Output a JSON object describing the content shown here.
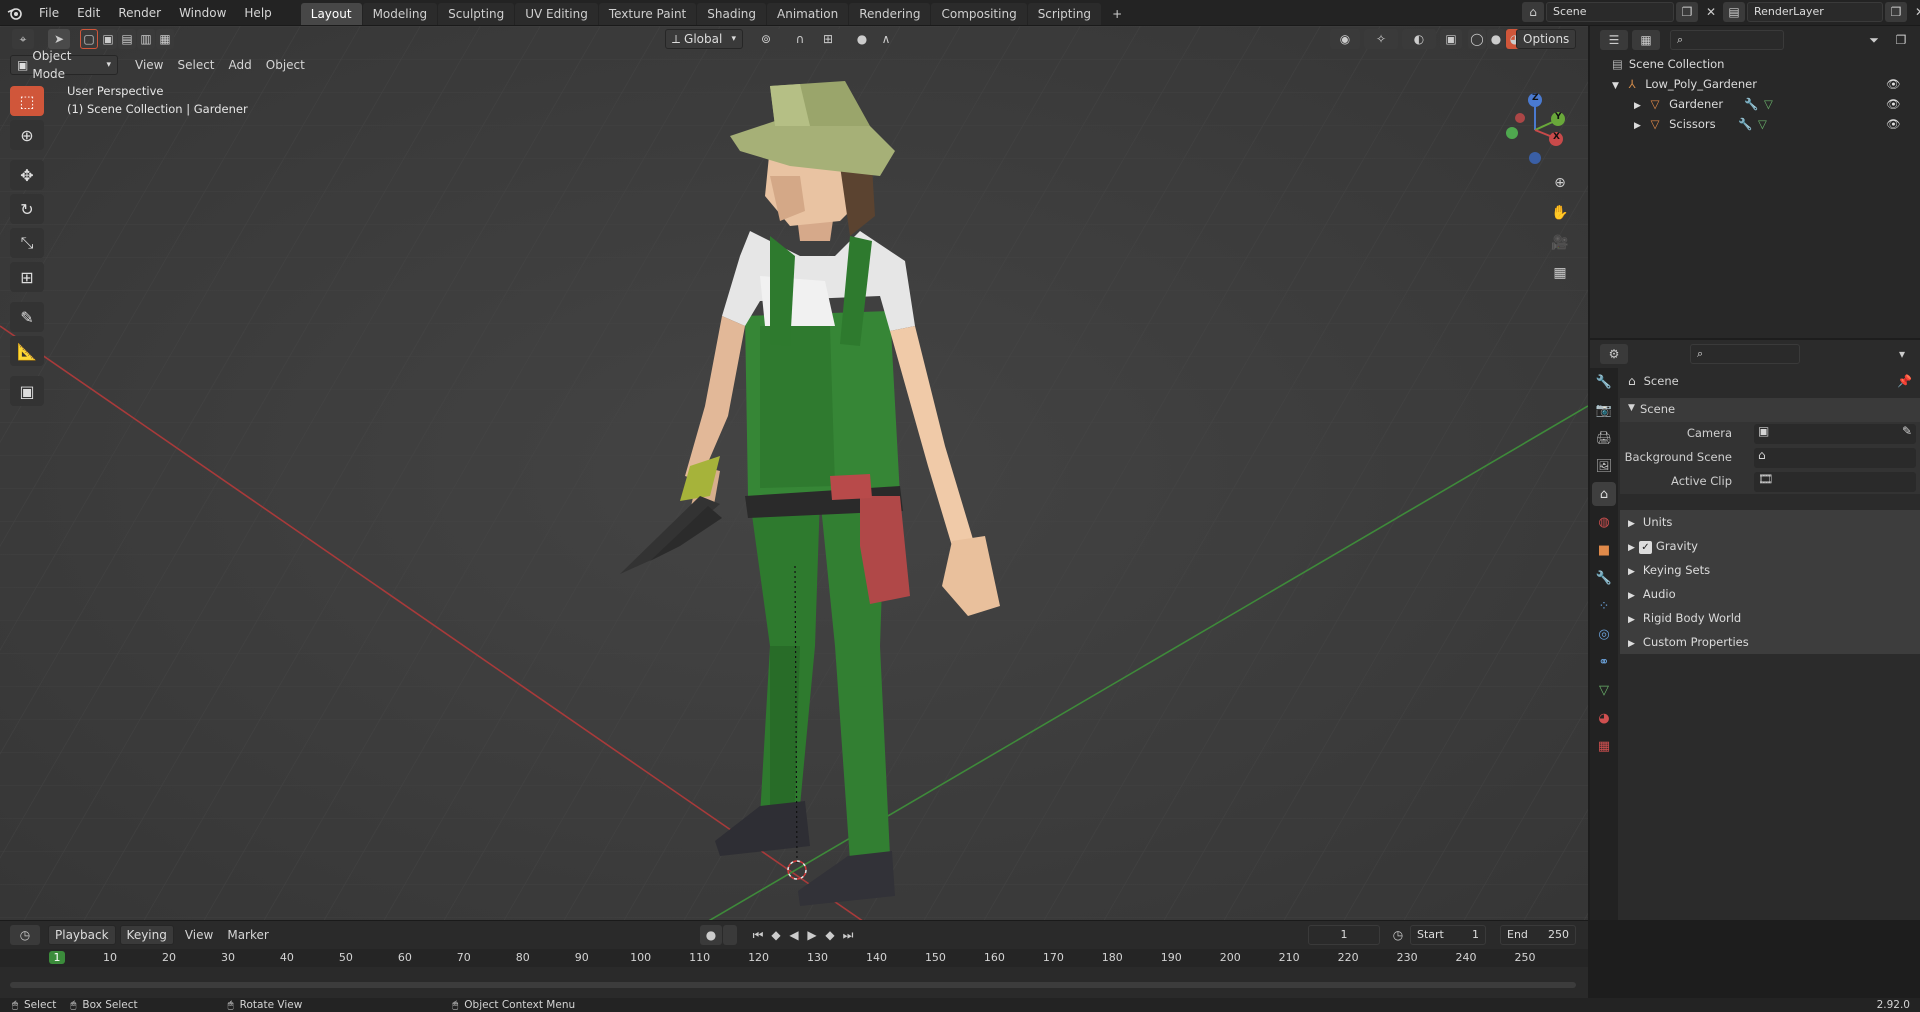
{
  "menu": [
    "File",
    "Edit",
    "Render",
    "Window",
    "Help"
  ],
  "workspaces": [
    {
      "label": "Layout",
      "active": true
    },
    {
      "label": "Modeling",
      "active": false
    },
    {
      "label": "Sculpting",
      "active": false
    },
    {
      "label": "UV Editing",
      "active": false
    },
    {
      "label": "Texture Paint",
      "active": false
    },
    {
      "label": "Shading",
      "active": false
    },
    {
      "label": "Animation",
      "active": false
    },
    {
      "label": "Rendering",
      "active": false
    },
    {
      "label": "Compositing",
      "active": false
    },
    {
      "label": "Scripting",
      "active": false
    }
  ],
  "add_workspace": "+",
  "scene_name": "Scene",
  "view_layer": "RenderLayer",
  "viewport_header": {
    "mode": "Object Mode",
    "menus": [
      "View",
      "Select",
      "Add",
      "Object"
    ],
    "orientation": "Global",
    "options": "Options"
  },
  "viewport_info": {
    "line1": "User Perspective",
    "line2": "(1) Scene Collection | Gardener"
  },
  "tools": [
    "select-box-icon",
    "cursor-icon",
    "move-icon",
    "rotate-icon",
    "scale-icon",
    "transform-icon",
    "annotate-icon",
    "measure-icon",
    "add-cube-icon"
  ],
  "nav_gizmo": {
    "z": "Z",
    "y": "Y",
    "x": "X"
  },
  "outliner": {
    "root": "Scene Collection",
    "items": [
      {
        "label": "Low_Poly_Gardener",
        "depth": 1
      },
      {
        "label": "Gardener",
        "depth": 2
      },
      {
        "label": "Scissors",
        "depth": 2
      }
    ]
  },
  "properties": {
    "title": "Scene",
    "panel_title": "Scene",
    "fields": [
      {
        "label": "Camera"
      },
      {
        "label": "Background Scene"
      },
      {
        "label": "Active Clip"
      }
    ],
    "subpanels": [
      {
        "label": "Units",
        "checkbox": false
      },
      {
        "label": "Gravity",
        "checkbox": true
      },
      {
        "label": "Keying Sets",
        "checkbox": false
      },
      {
        "label": "Audio",
        "checkbox": false
      },
      {
        "label": "Rigid Body World",
        "checkbox": false
      },
      {
        "label": "Custom Properties",
        "checkbox": false
      }
    ]
  },
  "timeline": {
    "menus": [
      "Playback",
      "Keying",
      "View",
      "Marker"
    ],
    "current_frame": "1",
    "start_label": "Start",
    "start": "1",
    "end_label": "End",
    "end": "250",
    "ticks": [
      "1",
      "10",
      "20",
      "30",
      "40",
      "50",
      "60",
      "70",
      "80",
      "90",
      "100",
      "110",
      "120",
      "130",
      "140",
      "150",
      "160",
      "170",
      "180",
      "190",
      "200",
      "210",
      "220",
      "230",
      "240",
      "250"
    ]
  },
  "status": {
    "select": "Select",
    "box_select": "Box Select",
    "rotate": "Rotate View",
    "context": "Object Context Menu",
    "version": "2.92.0"
  },
  "colors": {
    "accent": "#d0563a",
    "x_axis": "#a83a3a",
    "y_axis": "#3e8a3a",
    "active_frame": "#3b8c3b"
  }
}
